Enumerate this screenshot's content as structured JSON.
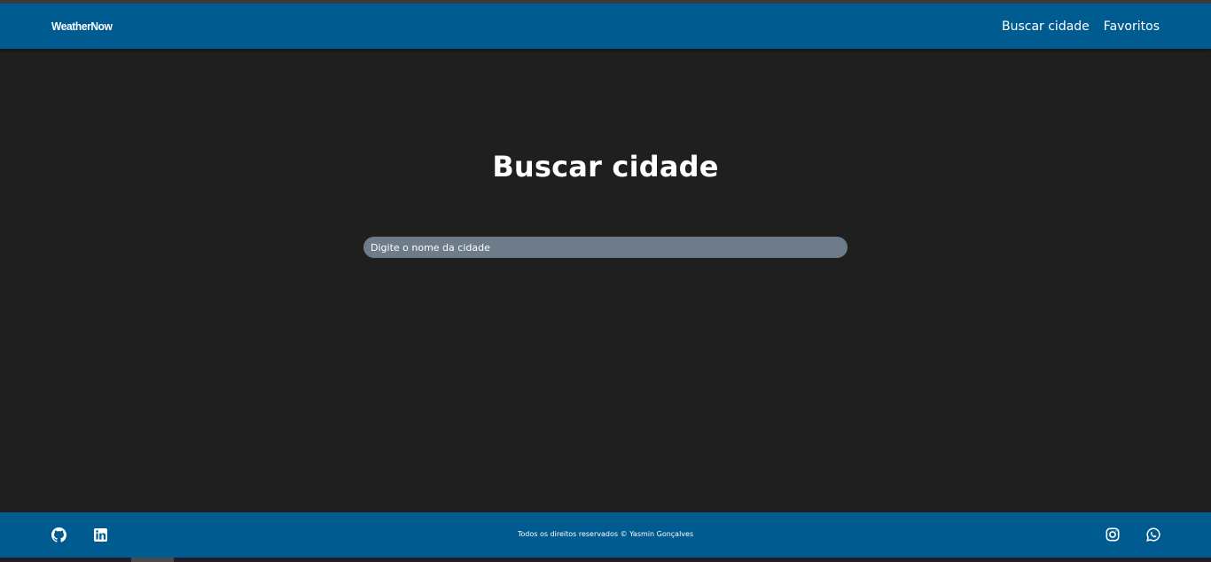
{
  "header": {
    "brand": "WeatherNow",
    "nav": [
      {
        "label": "Buscar cidade"
      },
      {
        "label": "Favoritos"
      }
    ]
  },
  "main": {
    "title": "Buscar cidade",
    "search": {
      "placeholder": "Digite o nome da cidade",
      "value": ""
    }
  },
  "footer": {
    "copyright": "Todos os direitos reservados © Yasmin Gonçalves",
    "left_icons": [
      "github-icon",
      "linkedin-icon"
    ],
    "right_icons": [
      "instagram-icon",
      "whatsapp-icon"
    ]
  },
  "colors": {
    "header_bg": "#005b91",
    "page_bg": "#1f1f1f",
    "input_bg": "#6e7b89"
  }
}
